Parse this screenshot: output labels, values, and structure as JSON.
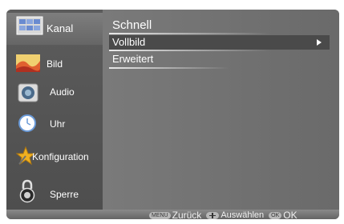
{
  "sidebar": {
    "items": [
      {
        "label": "Kanal",
        "icon": "tv-channel-icon",
        "active": true
      },
      {
        "label": "Bild",
        "icon": "picture-icon",
        "active": false
      },
      {
        "label": "Audio",
        "icon": "speaker-icon",
        "active": false
      },
      {
        "label": "Uhr",
        "icon": "clock-icon",
        "active": false
      },
      {
        "label": "Konfiguration",
        "icon": "star-tool-icon",
        "active": false
      },
      {
        "label": "Sperre",
        "icon": "lock-icon",
        "active": false
      }
    ]
  },
  "main": {
    "items": [
      {
        "label": "Schnell"
      },
      {
        "label": "Vollbild",
        "selected": true
      },
      {
        "label": "Erweitert"
      }
    ]
  },
  "footer": {
    "menu_key": "MENU",
    "back_label": "Zurück",
    "select_label": "Auswählen",
    "ok_key": "OK",
    "ok_label": "OK"
  }
}
